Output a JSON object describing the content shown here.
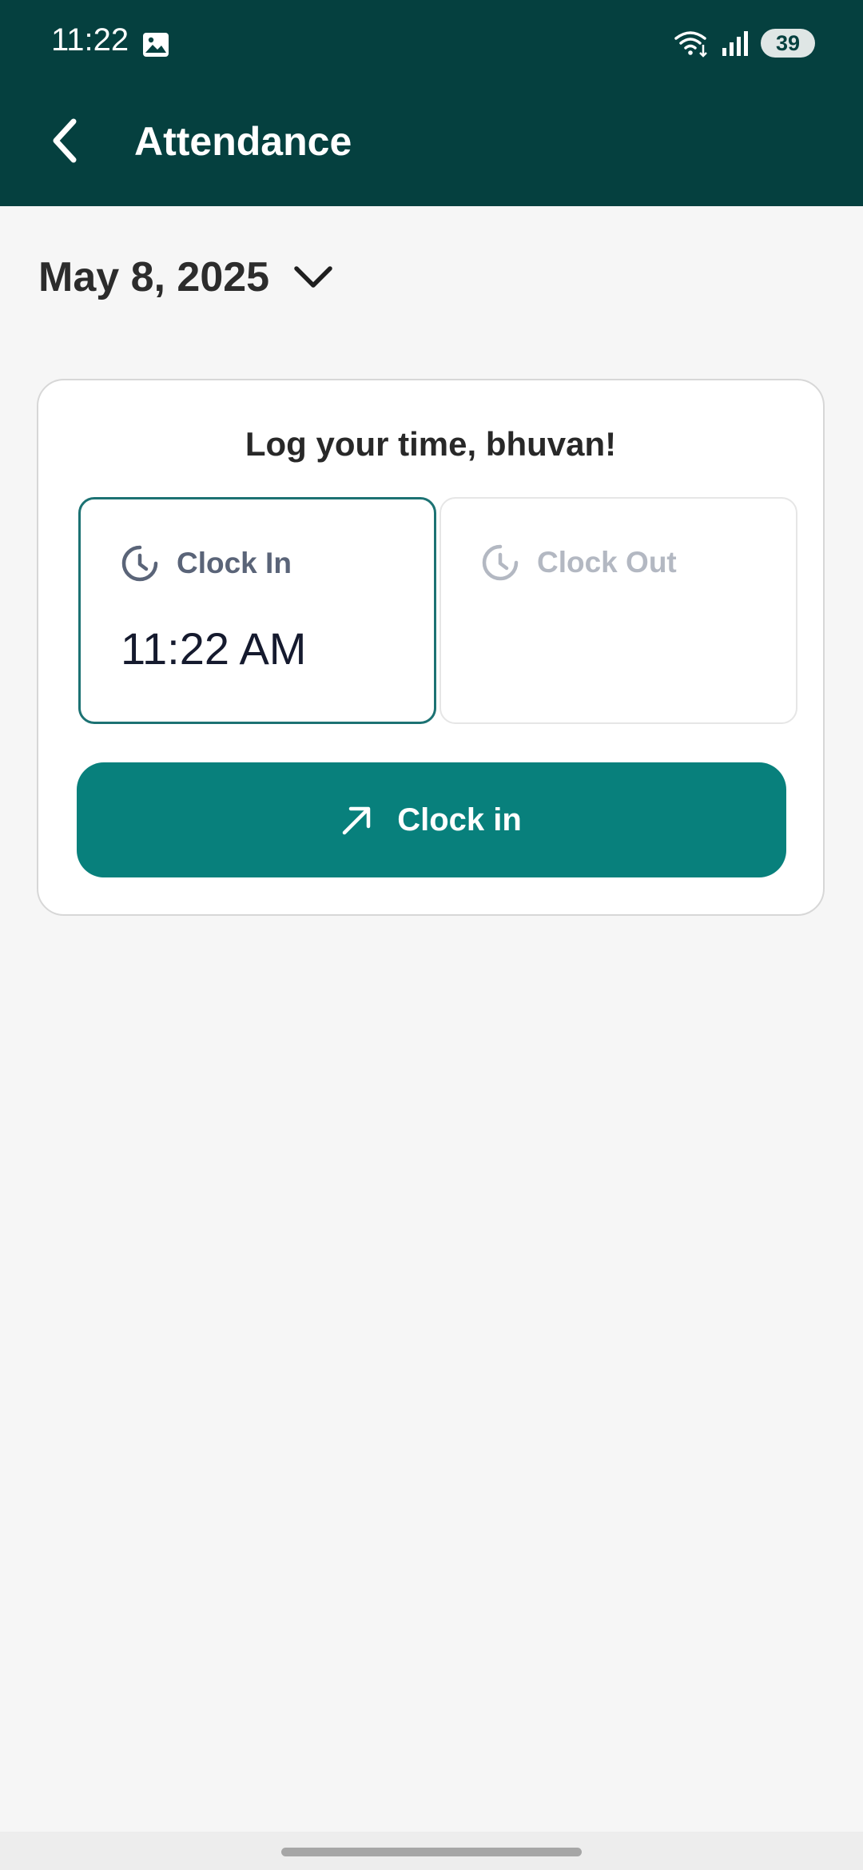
{
  "status_bar": {
    "time": "11:22",
    "battery": "39",
    "icons": [
      "gallery-icon",
      "wifi-icon",
      "signal-icon"
    ]
  },
  "app_bar": {
    "title": "Attendance",
    "back_icon": "chevron-left-icon"
  },
  "date_selector": {
    "date": "May 8, 2025",
    "icon": "chevron-down-icon"
  },
  "card": {
    "greeting": "Log your time, bhuvan!",
    "clock_in": {
      "label": "Clock In",
      "time": "11:22 AM",
      "icon": "clock-icon"
    },
    "clock_out": {
      "label": "Clock Out",
      "time": "",
      "icon": "clock-icon"
    },
    "button": {
      "label": "Clock in",
      "icon": "arrow-up-right-icon"
    }
  },
  "colors": {
    "app_bar": "#05403f",
    "accent": "#08807c",
    "background": "#f6f6f6"
  }
}
